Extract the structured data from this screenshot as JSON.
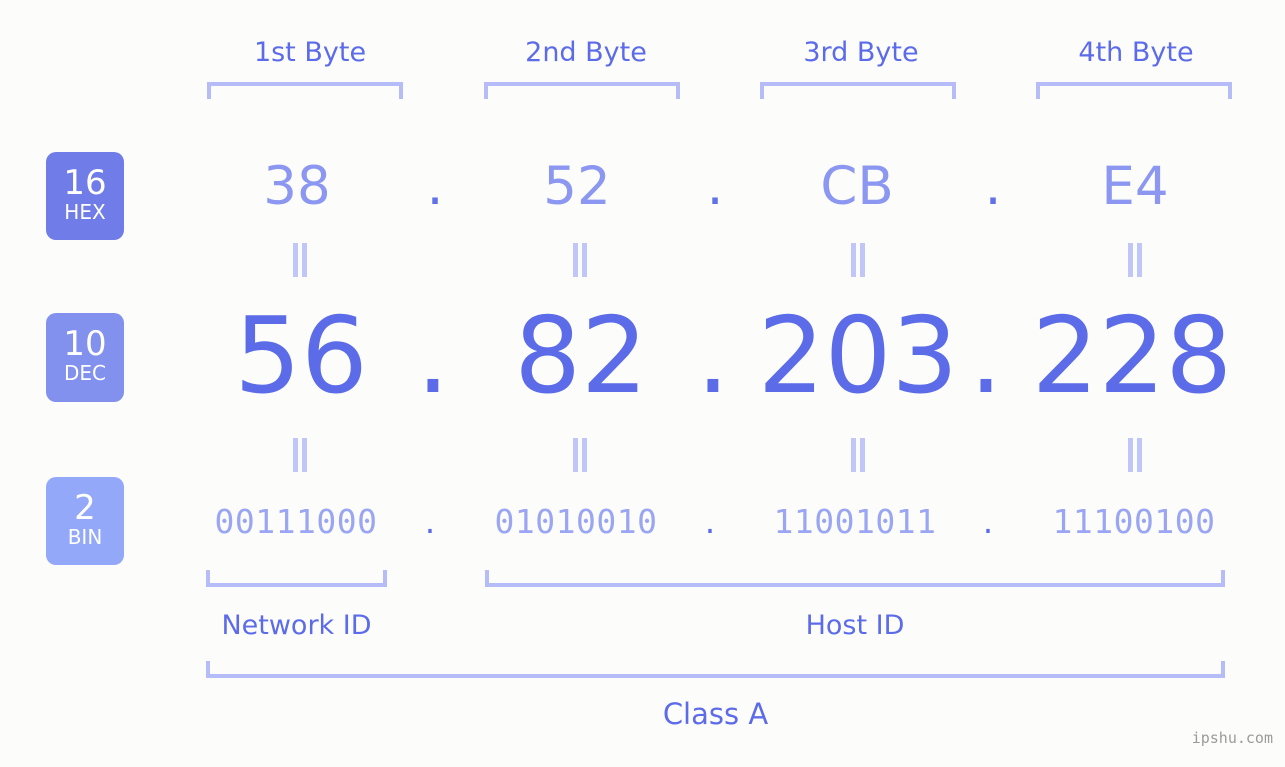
{
  "page": {
    "background_color": "#fcfdfa",
    "accent_color": "#5c6ce8",
    "bracket_color": "#b5bcf7",
    "watermark": "ipshu.com"
  },
  "byte_headers": [
    {
      "label": "1st Byte"
    },
    {
      "label": "2nd Byte"
    },
    {
      "label": "3rd Byte"
    },
    {
      "label": "4th Byte"
    }
  ],
  "bases": [
    {
      "number": "16",
      "name": "HEX",
      "color": "#707ce8"
    },
    {
      "number": "10",
      "name": "DEC",
      "color": "#8290ee"
    },
    {
      "number": "2",
      "name": "BIN",
      "color": "#93a8f8"
    }
  ],
  "rows": {
    "hex": {
      "values": [
        "38",
        "52",
        "CB",
        "E4"
      ],
      "separator": "."
    },
    "dec": {
      "values": [
        "56",
        "82",
        "203",
        "228"
      ],
      "separator": "."
    },
    "bin": {
      "values": [
        "00111000",
        "01010010",
        "11001011",
        "11100100"
      ],
      "separator": "."
    }
  },
  "equals_marks": {
    "symbol": "=",
    "count_per_row": 4
  },
  "sections": [
    {
      "label": "Network ID"
    },
    {
      "label": "Host ID"
    }
  ],
  "class": {
    "label": "Class A"
  },
  "chart_data": {
    "type": "table",
    "title": "IP Address 56.82.203.228 byte breakdown",
    "categories": [
      "1st Byte",
      "2nd Byte",
      "3rd Byte",
      "4th Byte"
    ],
    "series": [
      {
        "name": "HEX",
        "values": [
          "38",
          "52",
          "CB",
          "E4"
        ]
      },
      {
        "name": "DEC",
        "values": [
          "56",
          "82",
          "203",
          "228"
        ]
      },
      {
        "name": "BIN",
        "values": [
          "00111000",
          "01010010",
          "11001011",
          "11100100"
        ]
      }
    ],
    "annotations": [
      "Network ID",
      "Host ID",
      "Class A"
    ]
  }
}
